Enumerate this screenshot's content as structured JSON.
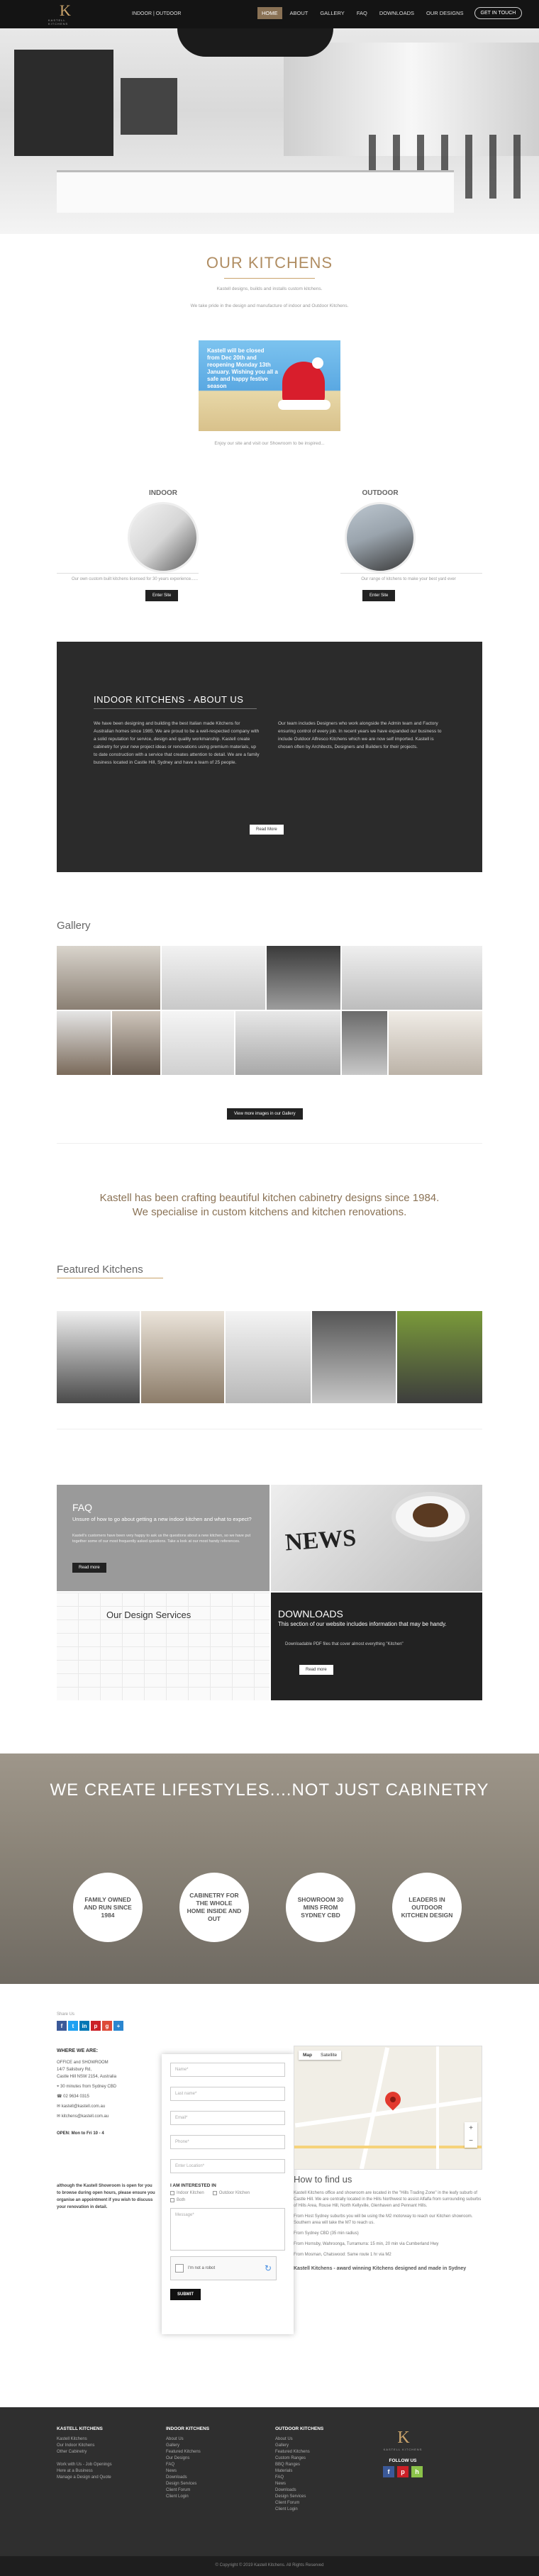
{
  "header": {
    "logo_text": "K",
    "logo_sub": "KASTELL KITCHENS",
    "subnav": "INDOOR  |  OUTDOOR",
    "nav": [
      "HOME",
      "ABOUT",
      "GALLERY",
      "FAQ",
      "DOWNLOADS",
      "OUR DESIGNS"
    ],
    "cta": "GET IN TOUCH"
  },
  "kitchens": {
    "title": "OUR KITCHENS",
    "lead1": "Kastell designs, builds and installs custom kitchens.",
    "lead2": "We take pride in the design and manufacture of indoor and Outdoor Kitchens.",
    "promo_text": "Kastell will be closed from Dec 20th and reopening Monday 13th January. Wishing you all a safe and happy festive season",
    "promo_caption": "Enjoy our site and visit our Showroom to be inspired...",
    "indoor_title": "INDOOR",
    "outdoor_title": "OUTDOOR",
    "indoor_desc": "Our own custom built kitchens licensed for 30 years experience......",
    "outdoor_desc": "Our range of kitchens to make your best yard ever",
    "enter_label": "Enter Site"
  },
  "about": {
    "title": "INDOOR KITCHENS - ABOUT US",
    "col1": "We have been designing and building the best Italian made Kitchens for Australian homes since 1985. We are proud to be a well-respected company with a solid reputation for service, design and quality workmanship. Kastell create cabinetry for your new project ideas or renovations using premium materials, up to date construction with a service that creates attention to detail. We are a family business located in Castle Hill, Sydney and have a team of 25 people.",
    "col2": "Our team includes Designers who work alongside the Admin team and Factory ensuring control of every job. In recent years we have expanded our business to include Outdoor Alfresco Kitchens which we are now self imported. Kastell is chosen often by Architects, Designers and Builders for their projects.",
    "read_more": "Read More"
  },
  "gallery": {
    "title": "Gallery",
    "button": "View more images in our Gallery"
  },
  "craft": {
    "line1": "Kastell has been crafting beautiful kitchen cabinetry designs since 1984.",
    "line2": "We specialise in custom kitchens and kitchen renovations."
  },
  "featured": {
    "title": "Featured Kitchens"
  },
  "faq": {
    "title": "FAQ",
    "sub": "Unsure of how to go about getting a new indoor kitchen and what to expect?",
    "body": "Kastell's customers have been very happy to ask us the questions about a new kitchen, so we have put together some of our most frequently asked questions. Take a look at our most handy references.",
    "button": "Read more"
  },
  "design": {
    "title": "Our Design Services"
  },
  "downloads": {
    "title": "DOWNLOADS",
    "sub": "This section of our website includes information that may be handy.",
    "item": "Downloadable PDF files that cover almost everything \"Kitchen\"",
    "button": "Read more"
  },
  "lifestyle": {
    "title": "WE CREATE LIFESTYLES....NOT JUST CABINETRY",
    "discs": [
      "FAMILY OWNED AND RUN SINCE 1984",
      "CABINETRY FOR THE WHOLE HOME INSIDE AND OUT",
      "SHOWROOM 30 MINS FROM SYDNEY CBD",
      "LEADERS IN OUTDOOR KITCHEN DESIGN"
    ]
  },
  "share": {
    "label": "Share Us",
    "icons": [
      "f",
      "t",
      "in",
      "p",
      "g",
      "+"
    ]
  },
  "contact": {
    "heading": "WHERE WE ARE:",
    "lines": [
      "OFFICE and SHOWROOM",
      "14/7 Salisbury Rd,",
      "Castle Hill NSW 2154, Australia",
      "30 minutes from Sydney CBD",
      "02 9634 0315",
      "kastell@kastell.com.au",
      "kitchens@kastell.com.au"
    ],
    "open": "OPEN: Mon to Fri  10 - 4",
    "note": "although the Kastell Showroom is open for you to browse during open hours, please ensure you organise an appointment if you wish to discuss your renovation in detail."
  },
  "form": {
    "fields": [
      "Name*",
      "Last name*",
      "Email*",
      "Phone*",
      "Enter Location*"
    ],
    "interest": "I AM INTERESTED IN",
    "options": [
      "Indoor Kitchen",
      "Outdoor Kitchen",
      "Both"
    ],
    "message": "Message*",
    "captcha": "I'm not a robot",
    "submit": "SUBMIT"
  },
  "map": {
    "tab_map": "Map",
    "tab_sat": "Satellite"
  },
  "find": {
    "title": "How to find us",
    "p1": "Kastell Kitchens office and showroom are located in the \"Hills Trading Zone\" in the leafy suburb of Castle Hill. We are centrally located in the Hills Northwest to assist Alfalfa from surrounding suburbs of Hills Area, Rouse Hill, North Kellyville, Glenhaven and Pennant Hills.",
    "p2": "From Host Sydney suburbs you will be using the M2 motorway to reach our Kitchen showroom. Southern area will take the M7 to reach us.",
    "p3": "From Sydney CBD (35 min radius)",
    "p4": "From Hornsby, Wahroonga, Turramurra: 15 min, 20 min via Cumberland Hwy",
    "p5": "From Mosman, Chatswood: Same route 1 hr via M2",
    "tag": "Kastell Kitchens - award winning Kitchens designed and made in Sydney"
  },
  "footer": {
    "col1_title": "KASTELL KITCHENS",
    "col1": [
      "Kastell Kitchens",
      "Our Indoor Kitchens",
      "Other Cabinetry",
      "",
      "Work with Us - Job Openings",
      "Here at a Business",
      "Manage a Design and Quote"
    ],
    "col2_title": "INDOOR KITCHENS",
    "col2": [
      "About Us",
      "Gallery",
      "Featured Kitchens",
      "Our Designs",
      "FAQ",
      "News",
      "Downloads",
      "Design Services",
      "Client Forum",
      "Client Login"
    ],
    "col3_title": "OUTDOOR KITCHENS",
    "col3": [
      "About Us",
      "Gallery",
      "Featured Kitchens",
      "Custom Ranges",
      "BBQ Ranges",
      "Materials",
      "FAQ",
      "News",
      "Downloads",
      "Design Services",
      "Client Forum",
      "Client Login"
    ],
    "follow": "FOLLOW US",
    "copyright": "© Copyright © 2019 Kastell Kitchens. All Rights Reserved"
  },
  "colors": {
    "accent": "#b08d62",
    "dark": "#2b2b2b",
    "nav_active": "#8a7255"
  }
}
